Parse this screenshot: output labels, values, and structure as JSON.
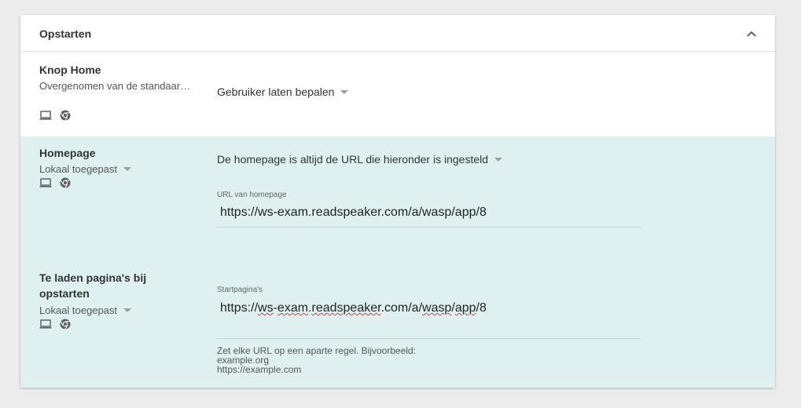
{
  "section": {
    "title": "Opstarten"
  },
  "rows": {
    "home_button": {
      "title": "Knop Home",
      "subtitle": "Overgenomen van de standaar…",
      "value": "Gebruiker laten bepalen"
    },
    "homepage": {
      "title": "Homepage",
      "subtitle": "Lokaal toegepast",
      "value": "De homepage is altijd de URL die hieronder is ingesteld",
      "url_label": "URL van homepage",
      "url_value": "https://ws-exam.readspeaker.com/a/wasp/app/8"
    },
    "startup_pages": {
      "title_line1": "Te laden pagina's bij",
      "title_line2": "opstarten",
      "subtitle": "Lokaal toegepast",
      "field_label": "Startpagina's",
      "url_parts": [
        "https://",
        "ws",
        "-",
        "exam",
        ".",
        "readspeaker",
        ".com/a/",
        "wasp",
        "/",
        "app",
        "/8"
      ],
      "hint_line1": "Zet elke URL op een aparte regel. Bijvoorbeeld:",
      "hint_line2": "example.org",
      "hint_line3": "https://example.com"
    }
  },
  "icons": {
    "device": "laptop-icon",
    "browser": "chrome-icon",
    "collapse": "chevron-up-icon"
  },
  "colors": {
    "teal_row": "#dff0f0",
    "background": "#ececec"
  }
}
